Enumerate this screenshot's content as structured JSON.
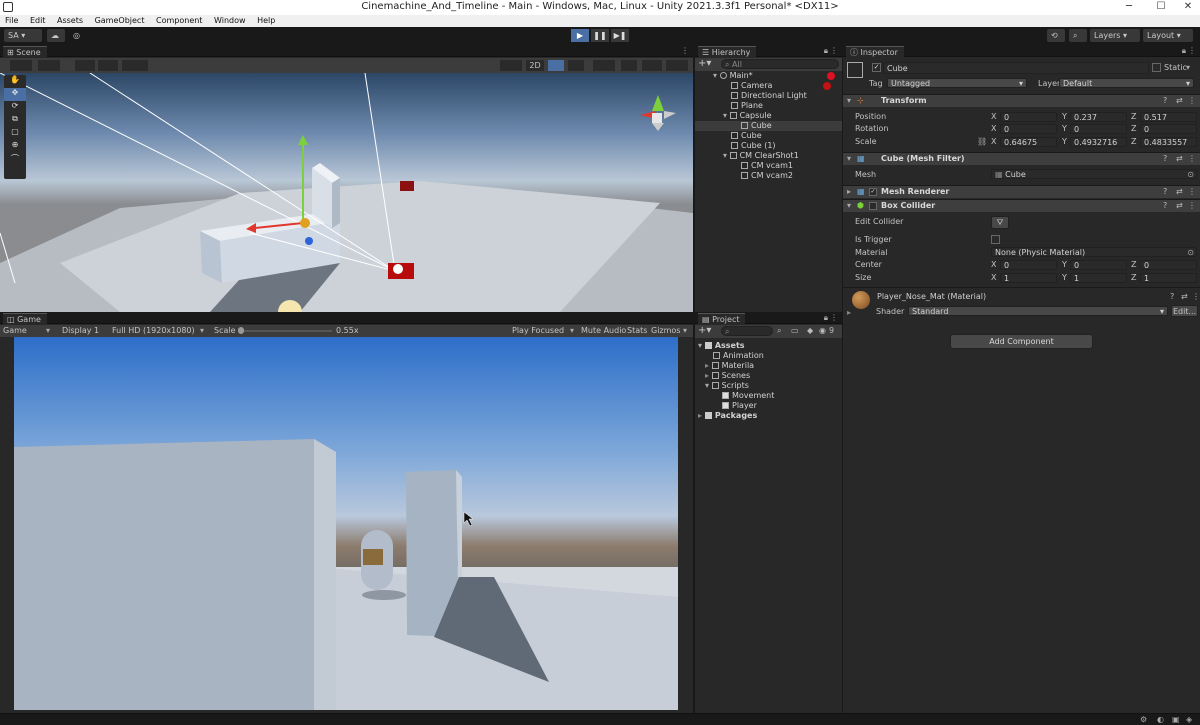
{
  "window": {
    "title": "Cinemachine_And_Timeline - Main - Windows, Mac, Linux - Unity 2021.3.3f1 Personal* <DX11>",
    "minimize": "─",
    "maximize": "☐",
    "close": "✕"
  },
  "menu": [
    "File",
    "Edit",
    "Assets",
    "GameObject",
    "Component",
    "Window",
    "Help"
  ],
  "toolbar": {
    "account": "SA ▾",
    "layers": "Layers",
    "layout": "Layout"
  },
  "scene": {
    "tab": "Scene",
    "mode_2d": "2D"
  },
  "game": {
    "tab": "Game",
    "display_mode": "Game",
    "display": "Display 1",
    "resolution": "Full HD (1920x1080)",
    "scale_label": "Scale",
    "scale_value": "0.55x",
    "play_focused": "Play Focused",
    "mute_audio": "Mute Audio",
    "stats": "Stats",
    "gizmos": "Gizmos"
  },
  "hierarchy": {
    "tab": "Hierarchy",
    "search_placeholder": "All",
    "items": [
      {
        "label": "Main*",
        "depth": 0
      },
      {
        "label": "Camera",
        "depth": 1
      },
      {
        "label": "Directional Light",
        "depth": 1
      },
      {
        "label": "Plane",
        "depth": 1
      },
      {
        "label": "Capsule",
        "depth": 1
      },
      {
        "label": "Cube",
        "depth": 2
      },
      {
        "label": "Cube",
        "depth": 1
      },
      {
        "label": "Cube (1)",
        "depth": 1
      },
      {
        "label": "CM ClearShot1",
        "depth": 1
      },
      {
        "label": "CM vcam1",
        "depth": 2
      },
      {
        "label": "CM vcam2",
        "depth": 2
      }
    ]
  },
  "project": {
    "tab": "Project",
    "count": "9",
    "items": [
      {
        "label": "Assets",
        "depth": 0
      },
      {
        "label": "Animation",
        "depth": 1
      },
      {
        "label": "Materila",
        "depth": 1
      },
      {
        "label": "Scenes",
        "depth": 1
      },
      {
        "label": "Scripts",
        "depth": 1
      },
      {
        "label": "Movement",
        "depth": 2
      },
      {
        "label": "Player",
        "depth": 2
      },
      {
        "label": "Packages",
        "depth": 0
      }
    ]
  },
  "inspector": {
    "tab": "Inspector",
    "object_name": "Cube",
    "static_label": "Static",
    "tag_label": "Tag",
    "tag_value": "Untagged",
    "layer_label": "Layer",
    "layer_value": "Default",
    "transform": {
      "title": "Transform",
      "position_label": "Position",
      "rotation_label": "Rotation",
      "scale_label": "Scale",
      "position": {
        "x": "0",
        "y": "0.237",
        "z": "0.517"
      },
      "rotation": {
        "x": "0",
        "y": "0",
        "z": "0"
      },
      "scale": {
        "x": "0.64675",
        "y": "0.4932716",
        "z": "0.4833557"
      }
    },
    "mesh_filter": {
      "title": "Cube (Mesh Filter)",
      "mesh_label": "Mesh",
      "mesh_value": "Cube"
    },
    "mesh_renderer": {
      "title": "Mesh Renderer"
    },
    "box_collider": {
      "title": "Box Collider",
      "edit_label": "Edit Collider",
      "trigger_label": "Is Trigger",
      "material_label": "Material",
      "material_value": "None (Physic Material)",
      "center_label": "Center",
      "size_label": "Size",
      "center": {
        "x": "0",
        "y": "0",
        "z": "0"
      },
      "size": {
        "x": "1",
        "y": "1",
        "z": "1"
      }
    },
    "material": {
      "title": "Player_Nose_Mat (Material)",
      "shader_label": "Shader",
      "shader_value": "Standard",
      "edit_label": "Edit..."
    },
    "add_component": "Add Component",
    "axis": {
      "x": "X",
      "y": "Y",
      "z": "Z"
    }
  }
}
